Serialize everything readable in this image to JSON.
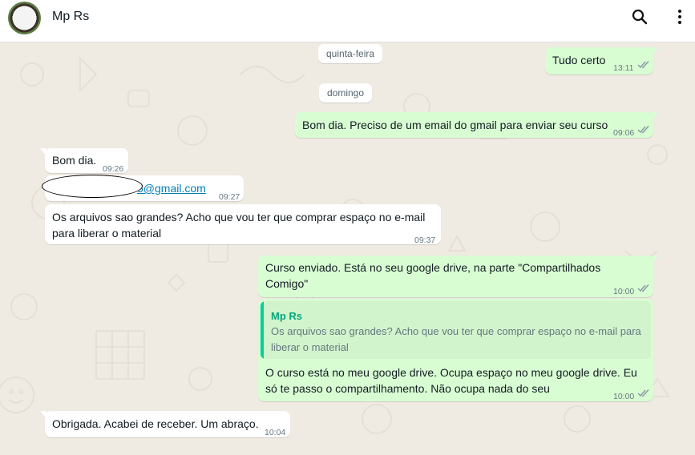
{
  "header": {
    "contact_name": "Mp Rs",
    "icons": [
      "search-icon",
      "menu-icon"
    ]
  },
  "date_chips": [
    "quinta-feira",
    "domingo"
  ],
  "messages": [
    {
      "dir": "out",
      "text": "Tudo certo",
      "time": "13:11",
      "status": "read"
    },
    {
      "dir": "out",
      "text": "Bom dia. Preciso de um email do gmail para enviar seu curso",
      "time": "09:06",
      "status": "read"
    },
    {
      "dir": "in",
      "text": "Bom dia.",
      "time": "09:26"
    },
    {
      "dir": "in",
      "text": "5@gmail.com",
      "time": "09:27",
      "redacted_prefix": true
    },
    {
      "dir": "in",
      "text_lines": [
        "Os arquivos sao grandes? Acho que vou ter que comprar espaço no e-mail",
        "para liberar o material"
      ],
      "time": "09:37"
    },
    {
      "dir": "out",
      "text_lines": [
        "Curso enviado. Está no seu google drive, na parte \"Compartilhados",
        "Comigo\""
      ],
      "time": "10:00",
      "status": "read"
    },
    {
      "dir": "out",
      "quote": {
        "author": "Mp Rs",
        "text_lines": [
          "Os arquivos sao grandes? Acho que vou ter que comprar espaço no e-mail para",
          "liberar o material"
        ]
      },
      "text_lines": [
        "O curso está no meu google drive. Ocupa espaço no meu google drive. Eu",
        "só te passo o compartilhamento. Não ocupa nada do seu"
      ],
      "time": "10:00",
      "status": "read"
    },
    {
      "dir": "in",
      "text": "Obrigada. Acabei de receber. Um abraço.",
      "time": "10:04"
    }
  ],
  "colors": {
    "chat_bg": "#efeae2",
    "incoming": "#ffffff",
    "outgoing": "#d9fdd3",
    "read_ticks": "#8696a0",
    "quote_accent": "#06cf9c"
  }
}
